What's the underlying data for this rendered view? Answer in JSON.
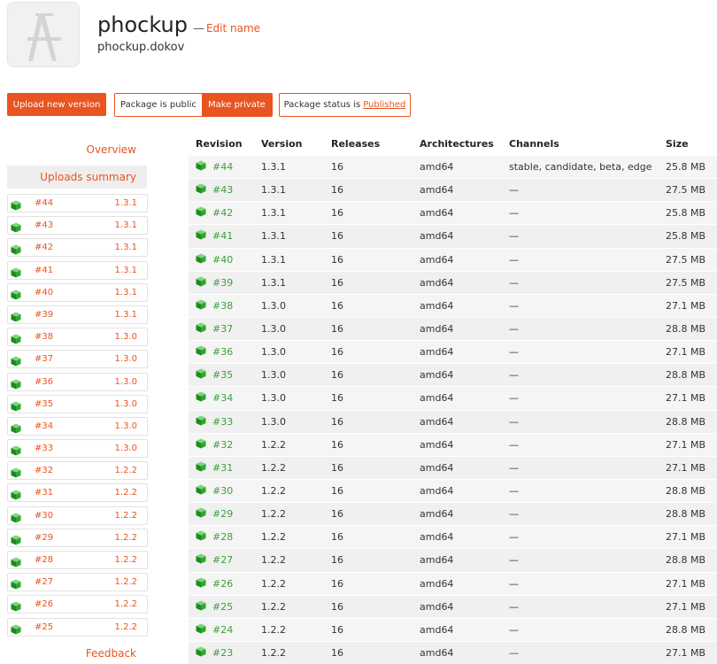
{
  "header": {
    "title": "phockup",
    "dash": "—",
    "edit_label": "Edit name",
    "package_id": "phockup.dokov",
    "icon": "app-icon-placeholder"
  },
  "actions": {
    "upload_label": "Upload new version",
    "public_label": "Package is public",
    "private_label": "Make private",
    "status_prefix": "Package status is",
    "status_value": "Published"
  },
  "sidebar": {
    "overview_label": "Overview",
    "summary_label": "Uploads summary",
    "feedback_label": "Feedback",
    "items": [
      {
        "rev": "#44",
        "ver": "1.3.1"
      },
      {
        "rev": "#43",
        "ver": "1.3.1"
      },
      {
        "rev": "#42",
        "ver": "1.3.1"
      },
      {
        "rev": "#41",
        "ver": "1.3.1"
      },
      {
        "rev": "#40",
        "ver": "1.3.1"
      },
      {
        "rev": "#39",
        "ver": "1.3.1"
      },
      {
        "rev": "#38",
        "ver": "1.3.0"
      },
      {
        "rev": "#37",
        "ver": "1.3.0"
      },
      {
        "rev": "#36",
        "ver": "1.3.0"
      },
      {
        "rev": "#35",
        "ver": "1.3.0"
      },
      {
        "rev": "#34",
        "ver": "1.3.0"
      },
      {
        "rev": "#33",
        "ver": "1.3.0"
      },
      {
        "rev": "#32",
        "ver": "1.2.2"
      },
      {
        "rev": "#31",
        "ver": "1.2.2"
      },
      {
        "rev": "#30",
        "ver": "1.2.2"
      },
      {
        "rev": "#29",
        "ver": "1.2.2"
      },
      {
        "rev": "#28",
        "ver": "1.2.2"
      },
      {
        "rev": "#27",
        "ver": "1.2.2"
      },
      {
        "rev": "#26",
        "ver": "1.2.2"
      },
      {
        "rev": "#25",
        "ver": "1.2.2"
      }
    ]
  },
  "table": {
    "headers": {
      "revision": "Revision",
      "version": "Version",
      "releases": "Releases",
      "architectures": "Architectures",
      "channels": "Channels",
      "size": "Size"
    },
    "rows": [
      {
        "rev": "#44",
        "ver": "1.3.1",
        "rel": "16",
        "arch": "amd64",
        "chan": "stable, candidate, beta, edge",
        "size": "25.8 MB"
      },
      {
        "rev": "#43",
        "ver": "1.3.1",
        "rel": "16",
        "arch": "amd64",
        "chan": "—",
        "size": "27.5 MB"
      },
      {
        "rev": "#42",
        "ver": "1.3.1",
        "rel": "16",
        "arch": "amd64",
        "chan": "—",
        "size": "25.8 MB"
      },
      {
        "rev": "#41",
        "ver": "1.3.1",
        "rel": "16",
        "arch": "amd64",
        "chan": "—",
        "size": "25.8 MB"
      },
      {
        "rev": "#40",
        "ver": "1.3.1",
        "rel": "16",
        "arch": "amd64",
        "chan": "—",
        "size": "27.5 MB"
      },
      {
        "rev": "#39",
        "ver": "1.3.1",
        "rel": "16",
        "arch": "amd64",
        "chan": "—",
        "size": "27.5 MB"
      },
      {
        "rev": "#38",
        "ver": "1.3.0",
        "rel": "16",
        "arch": "amd64",
        "chan": "—",
        "size": "27.1 MB"
      },
      {
        "rev": "#37",
        "ver": "1.3.0",
        "rel": "16",
        "arch": "amd64",
        "chan": "—",
        "size": "28.8 MB"
      },
      {
        "rev": "#36",
        "ver": "1.3.0",
        "rel": "16",
        "arch": "amd64",
        "chan": "—",
        "size": "27.1 MB"
      },
      {
        "rev": "#35",
        "ver": "1.3.0",
        "rel": "16",
        "arch": "amd64",
        "chan": "—",
        "size": "28.8 MB"
      },
      {
        "rev": "#34",
        "ver": "1.3.0",
        "rel": "16",
        "arch": "amd64",
        "chan": "—",
        "size": "27.1 MB"
      },
      {
        "rev": "#33",
        "ver": "1.3.0",
        "rel": "16",
        "arch": "amd64",
        "chan": "—",
        "size": "28.8 MB"
      },
      {
        "rev": "#32",
        "ver": "1.2.2",
        "rel": "16",
        "arch": "amd64",
        "chan": "—",
        "size": "27.1 MB"
      },
      {
        "rev": "#31",
        "ver": "1.2.2",
        "rel": "16",
        "arch": "amd64",
        "chan": "—",
        "size": "27.1 MB"
      },
      {
        "rev": "#30",
        "ver": "1.2.2",
        "rel": "16",
        "arch": "amd64",
        "chan": "—",
        "size": "28.8 MB"
      },
      {
        "rev": "#29",
        "ver": "1.2.2",
        "rel": "16",
        "arch": "amd64",
        "chan": "—",
        "size": "28.8 MB"
      },
      {
        "rev": "#28",
        "ver": "1.2.2",
        "rel": "16",
        "arch": "amd64",
        "chan": "—",
        "size": "27.1 MB"
      },
      {
        "rev": "#27",
        "ver": "1.2.2",
        "rel": "16",
        "arch": "amd64",
        "chan": "—",
        "size": "28.8 MB"
      },
      {
        "rev": "#26",
        "ver": "1.2.2",
        "rel": "16",
        "arch": "amd64",
        "chan": "—",
        "size": "27.1 MB"
      },
      {
        "rev": "#25",
        "ver": "1.2.2",
        "rel": "16",
        "arch": "amd64",
        "chan": "—",
        "size": "27.1 MB"
      },
      {
        "rev": "#24",
        "ver": "1.2.2",
        "rel": "16",
        "arch": "amd64",
        "chan": "—",
        "size": "28.8 MB"
      },
      {
        "rev": "#23",
        "ver": "1.2.2",
        "rel": "16",
        "arch": "amd64",
        "chan": "—",
        "size": "27.1 MB"
      }
    ]
  },
  "colors": {
    "accent": "#e95420",
    "revision_green": "#3c9e3c",
    "cube_green": "#2e9e2e"
  },
  "icons": {
    "row_icon": "package-cube-icon"
  }
}
